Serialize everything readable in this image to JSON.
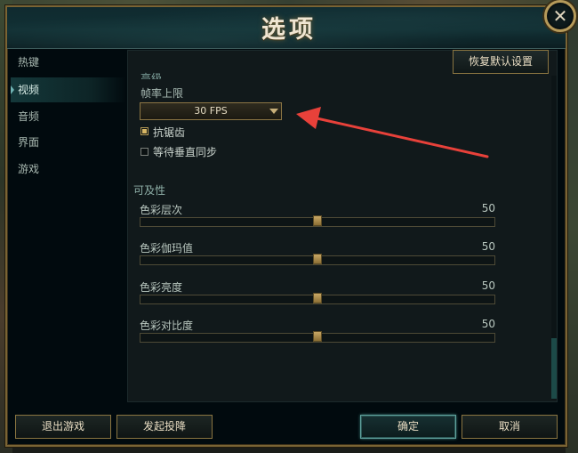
{
  "dialog": {
    "title": "选项",
    "close_label": "✕",
    "reset_label": "恢复默认设置"
  },
  "sidebar": {
    "items": [
      {
        "label": "热键",
        "active": false
      },
      {
        "label": "视频",
        "active": true
      },
      {
        "label": "音频",
        "active": false
      },
      {
        "label": "界面",
        "active": false
      },
      {
        "label": "游戏",
        "active": false
      }
    ]
  },
  "video": {
    "section_cut_label": "高级",
    "fps_label": "帧率上限",
    "fps_value": "30 FPS",
    "antialias_label": "抗锯齿",
    "antialias_checked": true,
    "vsync_label": "等待垂直同步",
    "vsync_checked": false
  },
  "accessibility": {
    "title": "可及性",
    "sliders": [
      {
        "label": "色彩层次",
        "value": "50",
        "fraction": 0.5
      },
      {
        "label": "色彩伽玛值",
        "value": "50",
        "fraction": 0.5
      },
      {
        "label": "色彩亮度",
        "value": "50",
        "fraction": 0.5
      },
      {
        "label": "色彩对比度",
        "value": "50",
        "fraction": 0.5
      }
    ]
  },
  "footer": {
    "exit_label": "退出游戏",
    "surrender_label": "发起投降",
    "ok_label": "确定",
    "cancel_label": "取消"
  },
  "colors": {
    "accent_gold": "#8a7541",
    "accent_teal": "#5fa09c",
    "annotation_red": "#e8413a"
  }
}
